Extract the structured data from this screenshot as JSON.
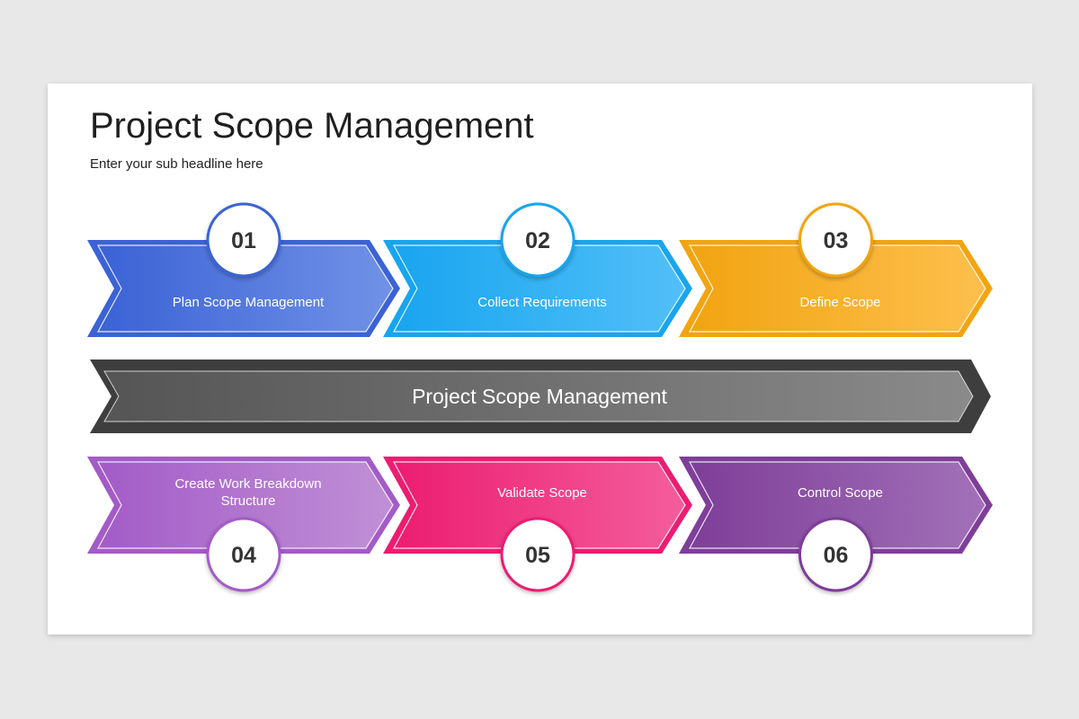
{
  "title": "Project Scope Management",
  "subtitle": "Enter your sub headline here",
  "center_banner": {
    "label": "Project Scope Management",
    "color": "#555555",
    "color_light": "#8a8a8a"
  },
  "steps": [
    {
      "number": "01",
      "label": "Plan Scope Management",
      "color": "#3b62d6",
      "color_light": "#7092e6"
    },
    {
      "number": "02",
      "label": "Collect Requirements",
      "color": "#18a5ef",
      "color_light": "#52bff8"
    },
    {
      "number": "03",
      "label": "Define Scope",
      "color": "#f2a411",
      "color_light": "#fdbf4d"
    },
    {
      "number": "04",
      "label": "Create Work Breakdown Structure",
      "label_lines": [
        "Create Work Breakdown",
        "Structure"
      ],
      "color": "#a35bc7",
      "color_light": "#c090d6"
    },
    {
      "number": "05",
      "label": "Validate Scope",
      "color": "#ec1d71",
      "color_light": "#f45d9c"
    },
    {
      "number": "06",
      "label": "Control Scope",
      "color": "#7e3e99",
      "color_light": "#a270b8"
    }
  ]
}
